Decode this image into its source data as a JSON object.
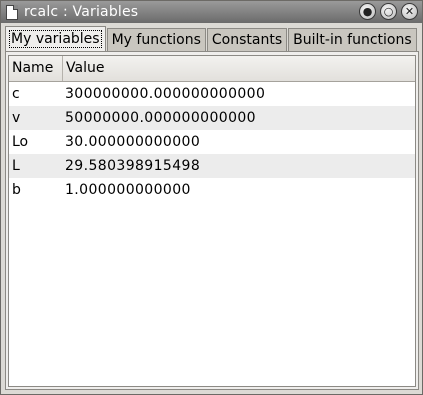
{
  "window": {
    "title": "rcalc : Variables"
  },
  "tabs": [
    {
      "label": "My variables",
      "active": true
    },
    {
      "label": "My functions",
      "active": false
    },
    {
      "label": "Constants",
      "active": false
    },
    {
      "label": "Built-in functions",
      "active": false
    }
  ],
  "table": {
    "columns": [
      "Name",
      "Value"
    ],
    "rows": [
      {
        "name": "c",
        "value": "300000000.000000000000"
      },
      {
        "name": "v",
        "value": "50000000.000000000000"
      },
      {
        "name": "Lo",
        "value": "30.000000000000"
      },
      {
        "name": "L",
        "value": "29.580398915498"
      },
      {
        "name": "b",
        "value": "1.000000000000"
      }
    ]
  },
  "icons": {
    "window_icon": "document-icon",
    "controls": [
      "minimize-icon",
      "maximize-icon",
      "close-icon"
    ]
  }
}
